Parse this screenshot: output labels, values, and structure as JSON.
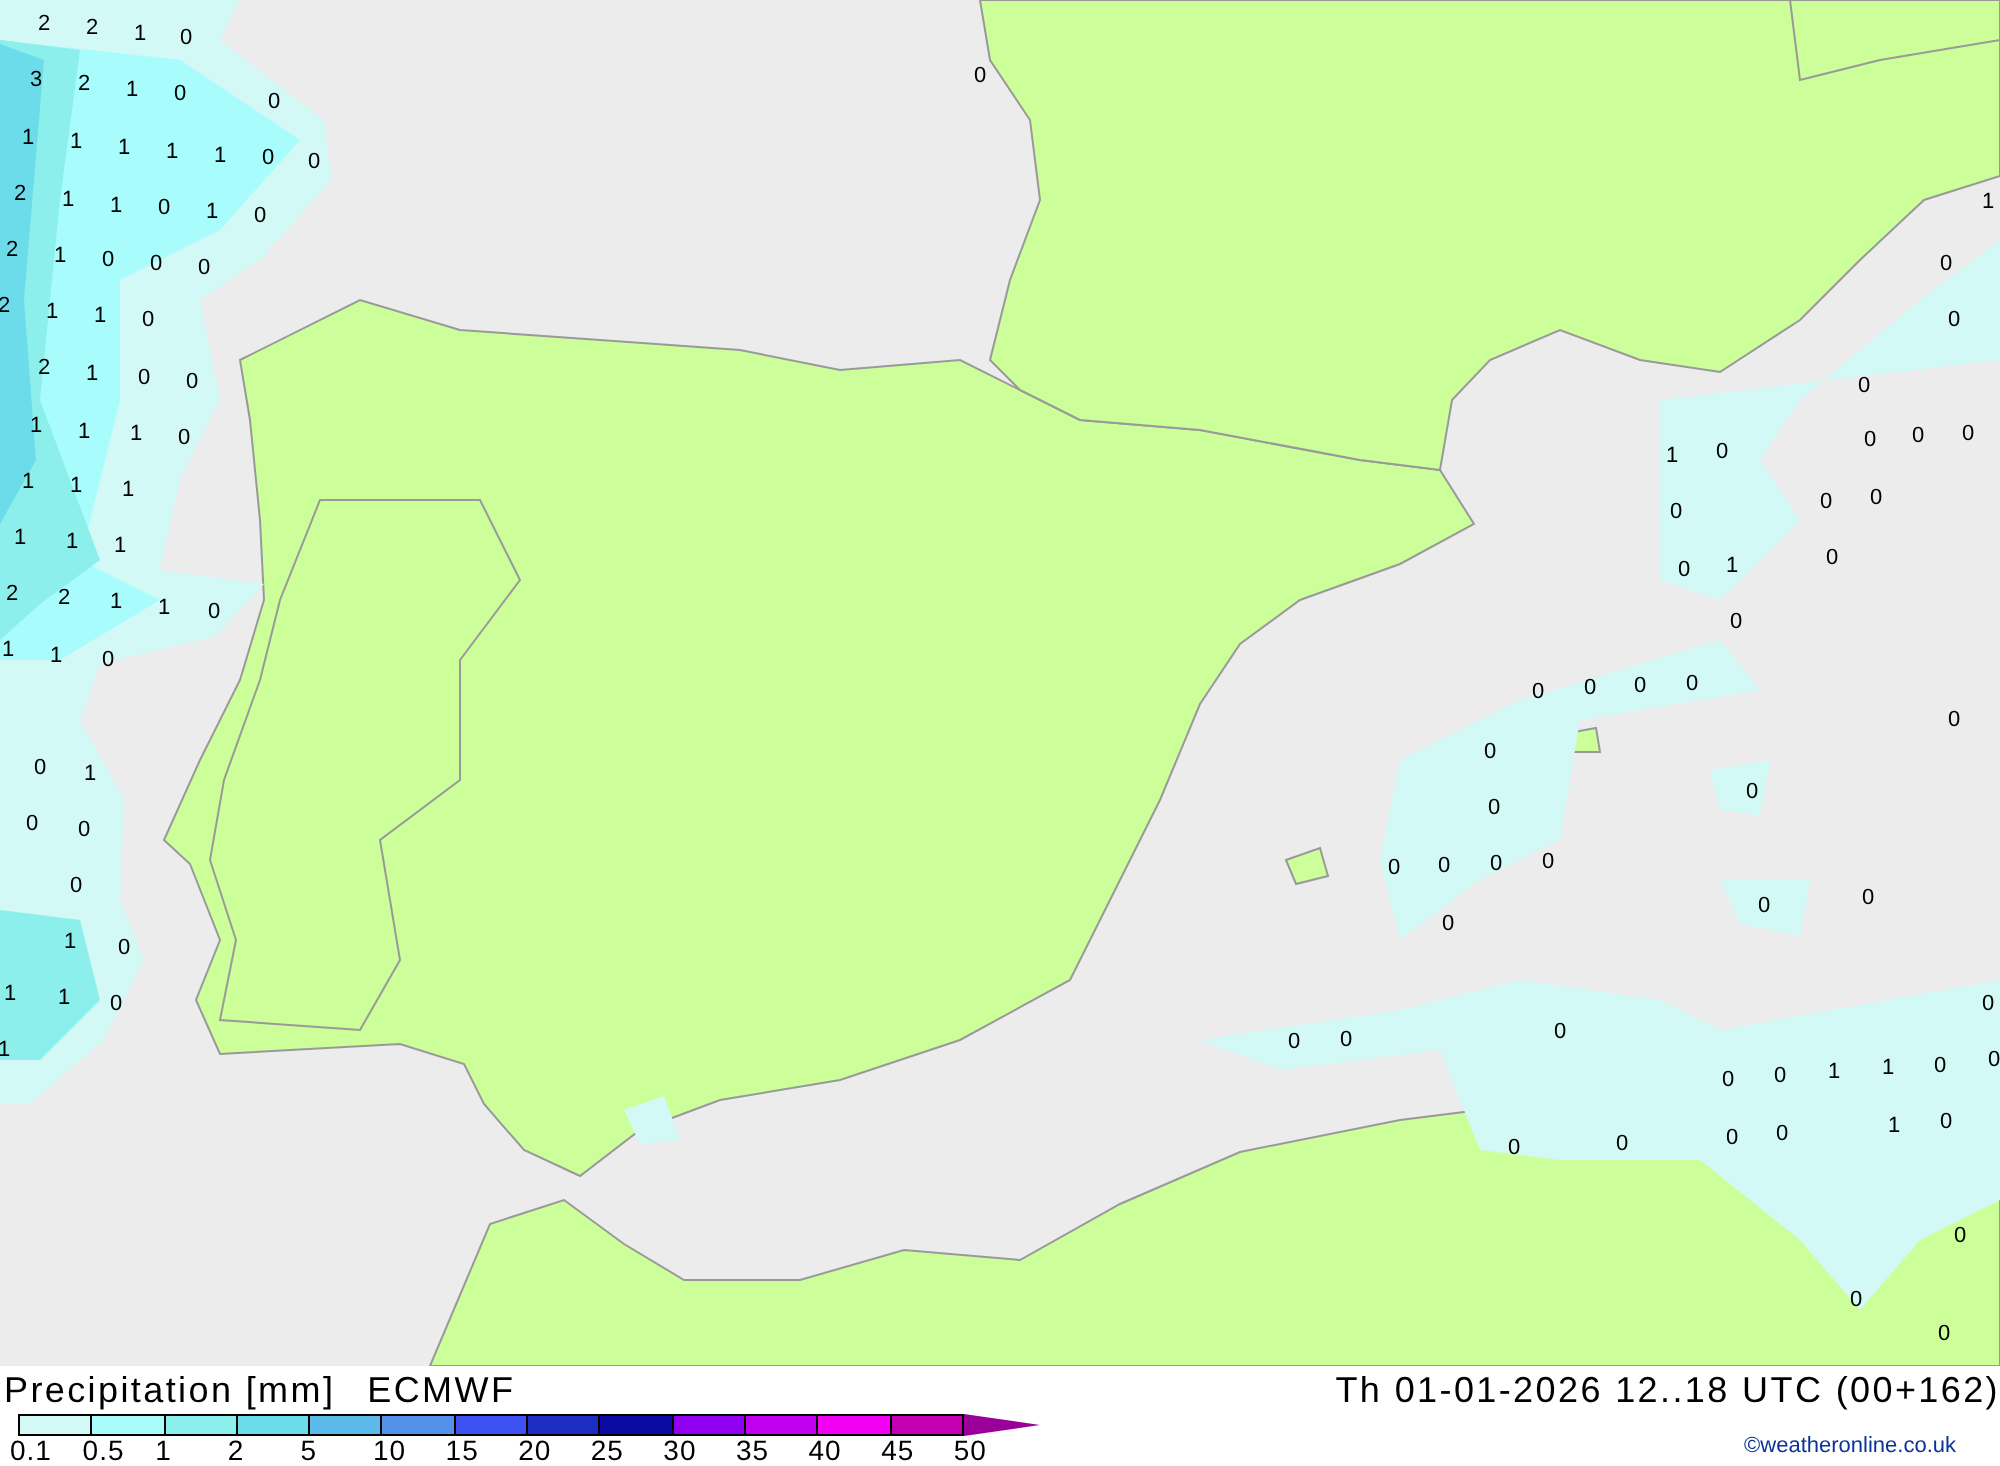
{
  "map_labels": [
    "2",
    "2",
    "1",
    "0",
    "3",
    "2",
    "1",
    "0",
    "0",
    "1",
    "1",
    "1",
    "1",
    "1",
    "0",
    "0",
    "2",
    "1",
    "1",
    "0",
    "1",
    "0",
    "2",
    "1",
    "0",
    "0",
    "0",
    "2",
    "1",
    "1",
    "0",
    "2",
    "1",
    "0",
    "0",
    "1",
    "1",
    "1",
    "0",
    "1",
    "1",
    "1",
    "1",
    "1",
    "1",
    "2",
    "2",
    "1",
    "1",
    "0",
    "1",
    "1",
    "0",
    "0",
    "1",
    "0",
    "0",
    "0",
    "1",
    "0",
    "1",
    "1",
    "0",
    "1",
    "0",
    "1",
    "0",
    "0",
    "0",
    "1",
    "0",
    "0",
    "0",
    "0",
    "0",
    "0",
    "0",
    "0",
    "1",
    "0",
    "0",
    "0",
    "0",
    "0",
    "0",
    "0",
    "0",
    "0",
    "0",
    "0",
    "0",
    "0",
    "0",
    "0",
    "0",
    "0",
    "0",
    "0",
    "0",
    "0",
    "0",
    "0",
    "1",
    "1",
    "0",
    "0",
    "0",
    "0",
    "1",
    "0",
    "0",
    "0",
    "0",
    "0",
    "0"
  ],
  "footer": {
    "title": "Precipitation [mm]",
    "model": "ECMWF",
    "valid_time": "Th 01-01-2026 12..18 UTC (00+162)",
    "credit": "©weatheronline.co.uk"
  },
  "legend": [
    {
      "label": "0.1",
      "color": "#d2f9f6"
    },
    {
      "label": "0.5",
      "color": "#a8fcfc"
    },
    {
      "label": "1",
      "color": "#8cefeb"
    },
    {
      "label": "2",
      "color": "#6cdcea"
    },
    {
      "label": "5",
      "color": "#5cbaea"
    },
    {
      "label": "10",
      "color": "#5292ea"
    },
    {
      "label": "15",
      "color": "#3c52f2"
    },
    {
      "label": "20",
      "color": "#1c2ec2"
    },
    {
      "label": "25",
      "color": "#0a0aa2"
    },
    {
      "label": "30",
      "color": "#9200f2"
    },
    {
      "label": "35",
      "color": "#c200f0"
    },
    {
      "label": "40",
      "color": "#f200f2"
    },
    {
      "label": "45",
      "color": "#c200b2"
    }
  ],
  "legend_end": {
    "label": "50",
    "color": "#9a0099"
  }
}
